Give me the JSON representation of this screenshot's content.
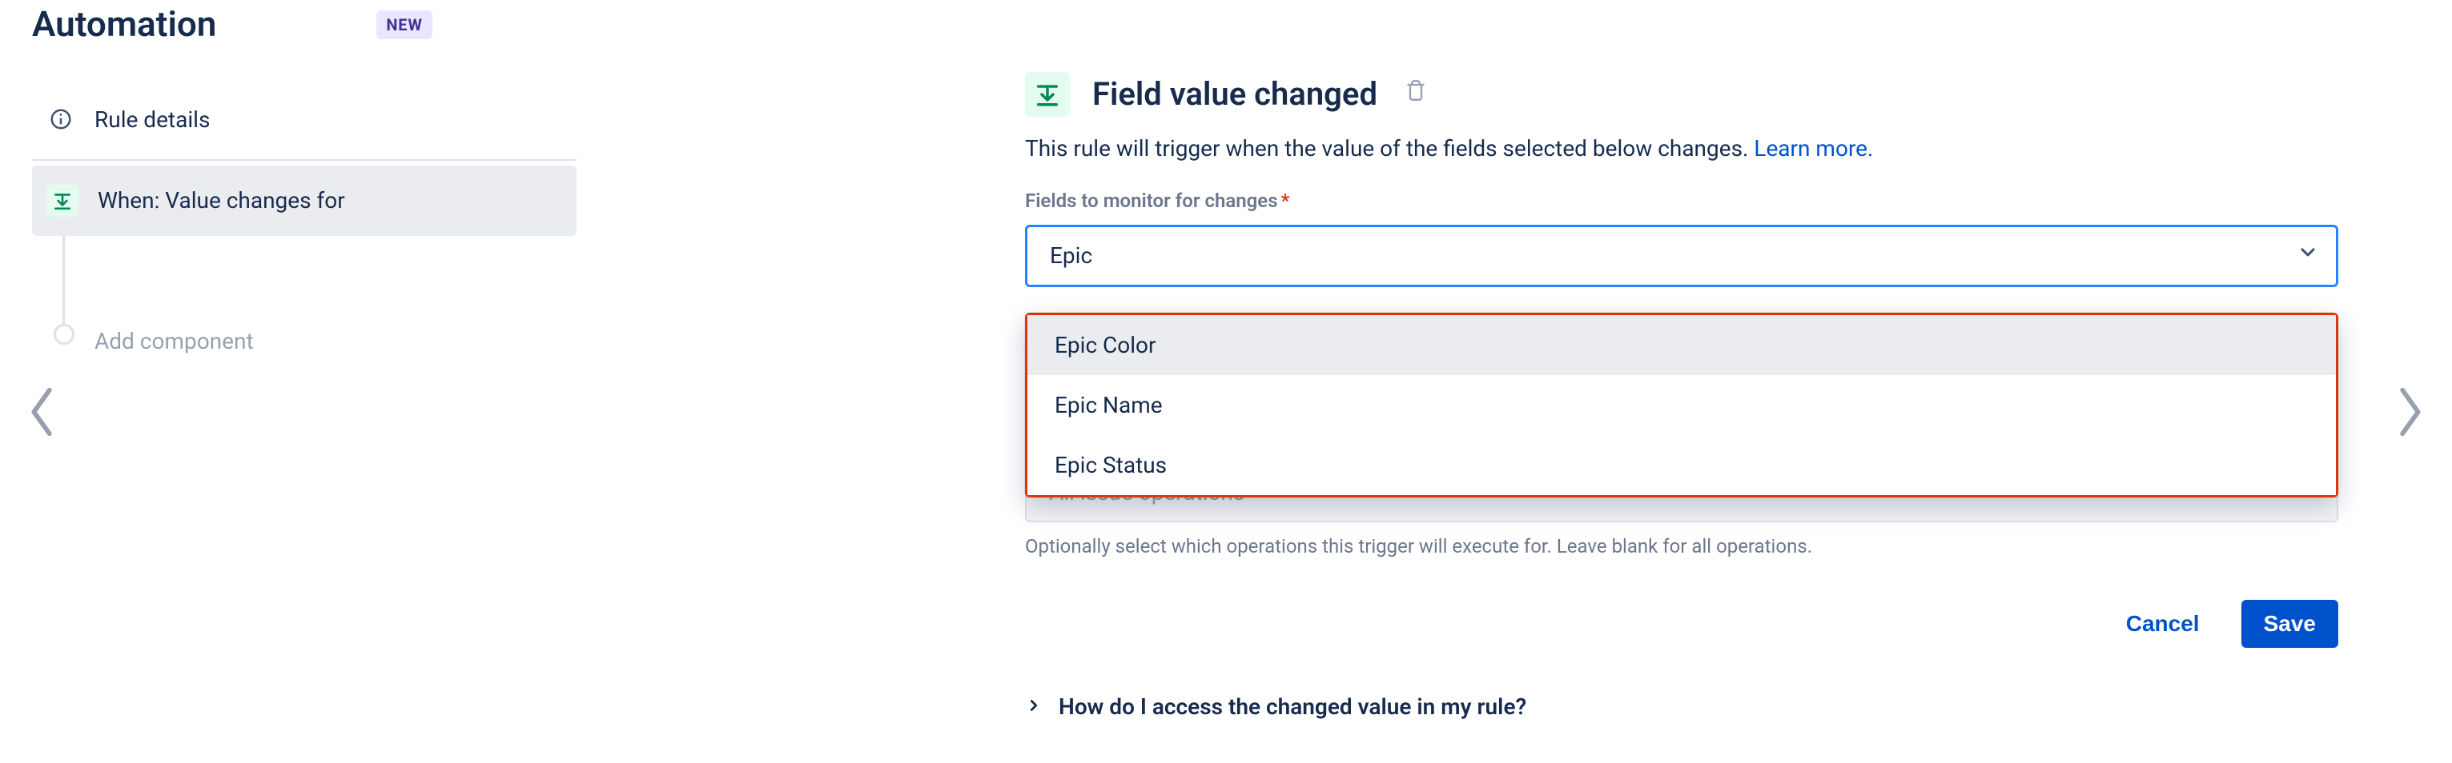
{
  "header": {
    "title": "Automation",
    "badge": "NEW"
  },
  "sidebar": {
    "rule_details_label": "Rule details",
    "trigger_label": "When: Value changes for",
    "add_component_label": "Add component"
  },
  "main": {
    "title": "Field value changed",
    "description_text": "This rule will trigger when the value of the fields selected below changes. ",
    "learn_more": "Learn more.",
    "fields_label": "Fields to monitor for changes",
    "fields_value": "Epic",
    "dropdown": {
      "options": [
        "Epic Color",
        "Epic Name",
        "Epic Status"
      ]
    },
    "operations_placeholder": "All issue operations",
    "operations_help": "Optionally select which operations this trigger will execute for. Leave blank for all operations.",
    "cancel_label": "Cancel",
    "save_label": "Save",
    "expander_label": "How do I access the changed value in my rule?"
  }
}
